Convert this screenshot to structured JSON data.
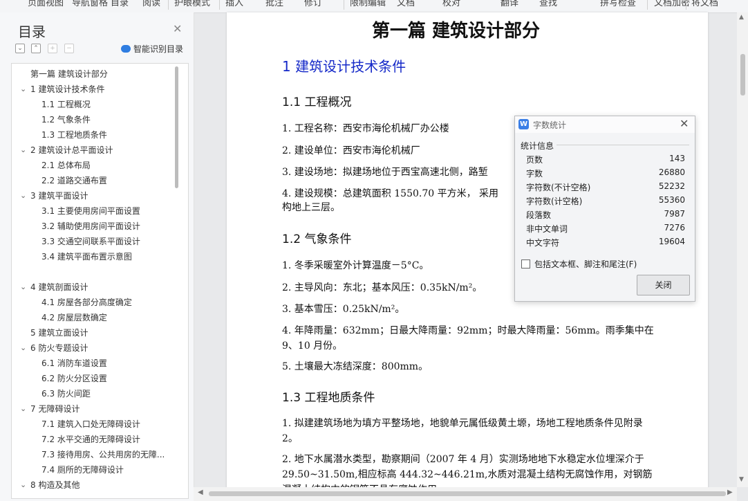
{
  "toolbar": {
    "items": [
      "页面视图",
      "导航窗格",
      "目录",
      "阅读",
      "护眼模式",
      "插入",
      "批注",
      "修订",
      "限制编辑",
      "文档",
      "校对",
      "翻译",
      "查找",
      "拼写检查",
      "文档加密",
      "将文档"
    ]
  },
  "toc": {
    "title": "目录",
    "smart_label": "智能识别目录",
    "items": [
      {
        "label": "第一篇  建筑设计部分",
        "level": 0,
        "chevron": false
      },
      {
        "label": "1  建筑设计技术条件",
        "level": 1,
        "chevron": true
      },
      {
        "label": "1.1 工程概况",
        "level": 2,
        "chevron": false
      },
      {
        "label": "1.2 气象条件",
        "level": 2,
        "chevron": false
      },
      {
        "label": "1.3 工程地质条件",
        "level": 2,
        "chevron": false
      },
      {
        "label": "2  建筑设计总平面设计",
        "level": 1,
        "chevron": true
      },
      {
        "label": "2.1 总体布局",
        "level": 2,
        "chevron": false
      },
      {
        "label": "2.2 道路交通布置",
        "level": 2,
        "chevron": false
      },
      {
        "label": "3  建筑平面设计",
        "level": 1,
        "chevron": true
      },
      {
        "label": "3.1 主要使用房间平面设置",
        "level": 2,
        "chevron": false
      },
      {
        "label": "3.2 辅助使用房间平面设计",
        "level": 2,
        "chevron": false
      },
      {
        "label": "3.3 交通空间联系平面设计",
        "level": 2,
        "chevron": false
      },
      {
        "label": "3.4 建筑平面布置示意图",
        "level": 2,
        "chevron": false
      },
      {
        "label": "",
        "level": 2,
        "chevron": false
      },
      {
        "label": "4 建筑剖面设计",
        "level": 1,
        "chevron": true
      },
      {
        "label": "4.1 房屋各部分高度确定",
        "level": 2,
        "chevron": false
      },
      {
        "label": "4.2 房屋层数确定",
        "level": 2,
        "chevron": false
      },
      {
        "label": "5 建筑立面设计",
        "level": 1,
        "chevron": false
      },
      {
        "label": "6 防火专题设计",
        "level": 1,
        "chevron": true
      },
      {
        "label": "6.1 消防车道设置",
        "level": 2,
        "chevron": false
      },
      {
        "label": "6.2 防火分区设置",
        "level": 2,
        "chevron": false
      },
      {
        "label": "6.3 防火间距",
        "level": 2,
        "chevron": false
      },
      {
        "label": "7 无障碍设计",
        "level": 1,
        "chevron": true
      },
      {
        "label": "7.1 建筑入口处无障碍设计",
        "level": 2,
        "chevron": false
      },
      {
        "label": "7.2 水平交通的无障碍设计",
        "level": 2,
        "chevron": false
      },
      {
        "label": "7.3 接待用房、公共用房的无障...",
        "level": 2,
        "chevron": false
      },
      {
        "label": "7.4 厕所的无障碍设计",
        "level": 2,
        "chevron": false
      },
      {
        "label": "8 构造及其他",
        "level": 1,
        "chevron": true
      }
    ]
  },
  "document": {
    "part_title": "第一篇  建筑设计部分",
    "h1": "1  建筑设计技术条件",
    "s11": "1.1 工程概况",
    "p11_1": "1. 工程名称：西安市海伦机械厂办公楼",
    "p11_2": "2.  建设单位：西安市海伦机械厂",
    "p11_3": "3. 建设场地：拟建场地位于西宝高速北侧，路堑",
    "p11_4a": "4. 建设规模：总建筑面积 1550.70 平方米， 采用",
    "p11_4b": "构地上三层。",
    "s12": "1.2 气象条件",
    "p12_1": "1. 冬季采暖室外计算温度－5°C。",
    "p12_2": "2. 主导风向：东北；基本风压：0.35kN/m²。",
    "p12_3": "3. 基本雪压：0.25kN/m²。",
    "p12_4": "4. 年降雨量：632mm；日最大降雨量：92mm；时最大降雨量：56mm。雨季集中在 9、10 月份。",
    "p12_5": "5. 土壤最大冻结深度：800mm。",
    "s13": "1.3 工程地质条件",
    "p13_1": "  1. 拟建建筑场地为填方平整场地，地貌单元属低级黄土塬，场地工程地质条件见附录 2。",
    "p13_2": "  2. 地下水属潜水类型，勘察期间（2007 年 4 月）实测场地地下水稳定水位埋深介于 29.50~31.50m,相应标高 444.32~446.21m,水质对混凝土结构无腐蚀作用，对钢筋混凝土结构中的钢筋不具有腐蚀作用。"
  },
  "dialog": {
    "icon_letter": "W",
    "title": "字数统计",
    "group_label": "统计信息",
    "stats": [
      {
        "label": "页数",
        "value": "143"
      },
      {
        "label": "字数",
        "value": "26880"
      },
      {
        "label": "字符数(不计空格)",
        "value": "52232"
      },
      {
        "label": "字符数(计空格)",
        "value": "55360"
      },
      {
        "label": "段落数",
        "value": "7987"
      },
      {
        "label": "非中文单词",
        "value": "7276"
      },
      {
        "label": "中文字符",
        "value": "19604"
      }
    ],
    "checkbox_label": "包括文本框、脚注和尾注(F)",
    "checkbox_checked": false,
    "close_label": "关闭"
  },
  "colors": {
    "heading_blue": "#1428c8",
    "accent_blue": "#2f7de1"
  }
}
